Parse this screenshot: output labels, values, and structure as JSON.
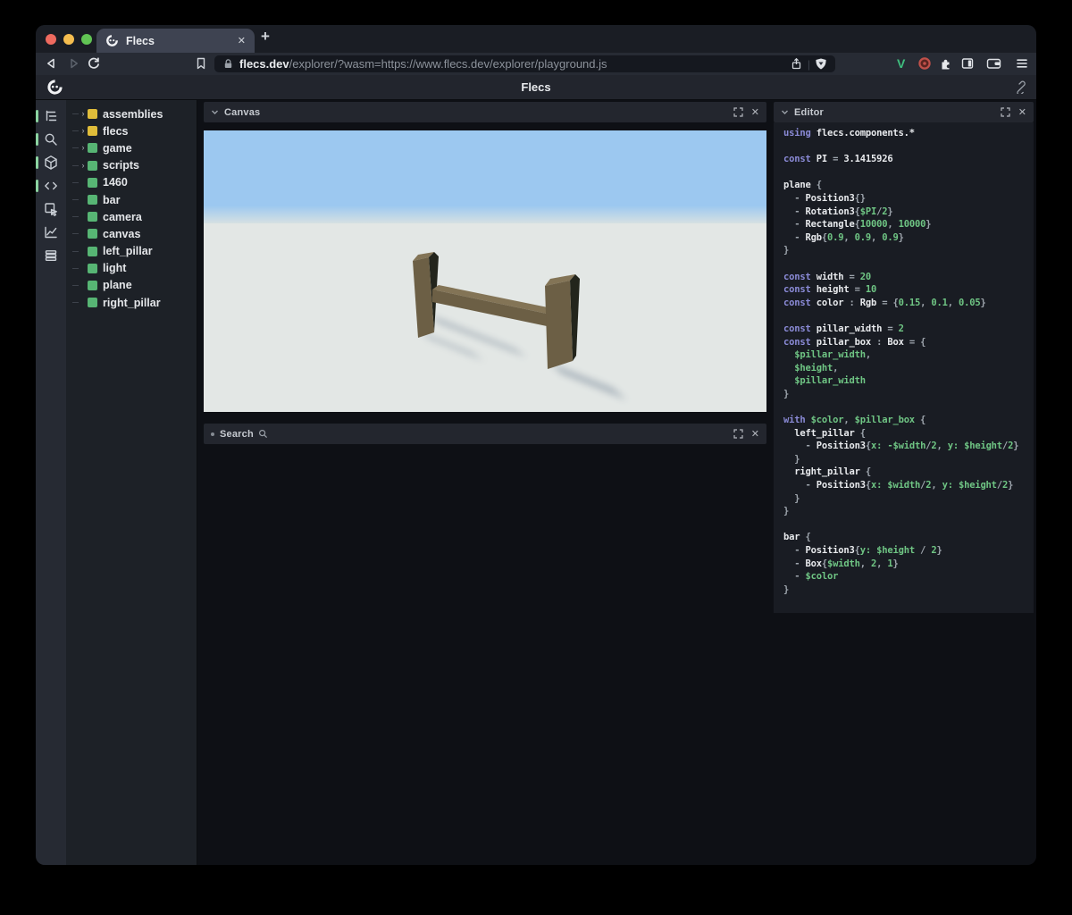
{
  "browser": {
    "traffic_lights": {
      "close": "#ee6a5f",
      "minimize": "#f5bd4f",
      "zoom": "#61c454"
    },
    "tab": {
      "title": "Flecs",
      "close_label": "✕"
    },
    "new_tab_label": "+",
    "url": {
      "domain": "flecs.dev",
      "path": "/explorer/?wasm=https://www.flecs.dev/explorer/playground.js"
    },
    "extensions": {
      "v_label": "V"
    }
  },
  "app": {
    "header": {
      "title": "Flecs"
    },
    "activity_bar": {
      "active_color": "#8bd3a0",
      "items": [
        {
          "name": "outliner",
          "active": true
        },
        {
          "name": "search",
          "active": true
        },
        {
          "name": "scene",
          "active": true
        },
        {
          "name": "script",
          "active": true
        },
        {
          "name": "inspect",
          "active": false
        },
        {
          "name": "stats",
          "active": false
        },
        {
          "name": "tables",
          "active": false
        }
      ]
    },
    "tree": {
      "colors": {
        "yellow": "#e0bd3a",
        "green": "#57b574"
      },
      "expander": "›",
      "items": [
        {
          "label": "assemblies",
          "dot": "yellow",
          "expandable": true
        },
        {
          "label": "flecs",
          "dot": "yellow",
          "expandable": true
        },
        {
          "label": "game",
          "dot": "green",
          "expandable": true
        },
        {
          "label": "scripts",
          "dot": "green",
          "expandable": true
        },
        {
          "label": "1460",
          "dot": "green",
          "expandable": false
        },
        {
          "label": "bar",
          "dot": "green",
          "expandable": false
        },
        {
          "label": "camera",
          "dot": "green",
          "expandable": false
        },
        {
          "label": "canvas",
          "dot": "green",
          "expandable": false
        },
        {
          "label": "left_pillar",
          "dot": "green",
          "expandable": false
        },
        {
          "label": "light",
          "dot": "green",
          "expandable": false
        },
        {
          "label": "plane",
          "dot": "green",
          "expandable": false
        },
        {
          "label": "right_pillar",
          "dot": "green",
          "expandable": false
        }
      ]
    },
    "panels": {
      "canvas": {
        "title": "Canvas",
        "close_label": "✕"
      },
      "search": {
        "title": "Search",
        "close_label": "✕"
      },
      "editor": {
        "title": "Editor",
        "close_label": "✕",
        "code_lines": [
          [
            {
              "t": "using ",
              "c": "k"
            },
            {
              "t": "flecs.components.*",
              "c": "i"
            }
          ],
          [],
          [
            {
              "t": "const ",
              "c": "k"
            },
            {
              "t": "PI",
              "c": "i"
            },
            {
              "t": " = ",
              "c": "p"
            },
            {
              "t": "3.1415926",
              "c": "i"
            }
          ],
          [],
          [
            {
              "t": "plane",
              "c": "i"
            },
            {
              "t": " {",
              "c": "p"
            }
          ],
          [
            {
              "t": "  - ",
              "c": "p"
            },
            {
              "t": "Position3",
              "c": "i"
            },
            {
              "t": "{}",
              "c": "p"
            }
          ],
          [
            {
              "t": "  - ",
              "c": "p"
            },
            {
              "t": "Rotation3",
              "c": "i"
            },
            {
              "t": "{",
              "c": "p"
            },
            {
              "t": "$PI",
              "c": "n"
            },
            {
              "t": "/",
              "c": "p"
            },
            {
              "t": "2",
              "c": "n"
            },
            {
              "t": "}",
              "c": "p"
            }
          ],
          [
            {
              "t": "  - ",
              "c": "p"
            },
            {
              "t": "Rectangle",
              "c": "i"
            },
            {
              "t": "{",
              "c": "p"
            },
            {
              "t": "10000",
              "c": "n"
            },
            {
              "t": ", ",
              "c": "p"
            },
            {
              "t": "10000",
              "c": "n"
            },
            {
              "t": "}",
              "c": "p"
            }
          ],
          [
            {
              "t": "  - ",
              "c": "p"
            },
            {
              "t": "Rgb",
              "c": "i"
            },
            {
              "t": "{",
              "c": "p"
            },
            {
              "t": "0.9",
              "c": "n"
            },
            {
              "t": ", ",
              "c": "p"
            },
            {
              "t": "0.9",
              "c": "n"
            },
            {
              "t": ", ",
              "c": "p"
            },
            {
              "t": "0.9",
              "c": "n"
            },
            {
              "t": "}",
              "c": "p"
            }
          ],
          [
            {
              "t": "}",
              "c": "p"
            }
          ],
          [],
          [
            {
              "t": "const ",
              "c": "k"
            },
            {
              "t": "width",
              "c": "i"
            },
            {
              "t": " = ",
              "c": "p"
            },
            {
              "t": "20",
              "c": "n"
            }
          ],
          [
            {
              "t": "const ",
              "c": "k"
            },
            {
              "t": "height",
              "c": "i"
            },
            {
              "t": " = ",
              "c": "p"
            },
            {
              "t": "10",
              "c": "n"
            }
          ],
          [
            {
              "t": "const ",
              "c": "k"
            },
            {
              "t": "color",
              "c": "i"
            },
            {
              "t": " : ",
              "c": "p"
            },
            {
              "t": "Rgb",
              "c": "i"
            },
            {
              "t": " = {",
              "c": "p"
            },
            {
              "t": "0.15",
              "c": "n"
            },
            {
              "t": ", ",
              "c": "p"
            },
            {
              "t": "0.1",
              "c": "n"
            },
            {
              "t": ", ",
              "c": "p"
            },
            {
              "t": "0.05",
              "c": "n"
            },
            {
              "t": "}",
              "c": "p"
            }
          ],
          [],
          [
            {
              "t": "const ",
              "c": "k"
            },
            {
              "t": "pillar_width",
              "c": "i"
            },
            {
              "t": " = ",
              "c": "p"
            },
            {
              "t": "2",
              "c": "n"
            }
          ],
          [
            {
              "t": "const ",
              "c": "k"
            },
            {
              "t": "pillar_box",
              "c": "i"
            },
            {
              "t": " : ",
              "c": "p"
            },
            {
              "t": "Box",
              "c": "i"
            },
            {
              "t": " = {",
              "c": "p"
            }
          ],
          [
            {
              "t": "  $pillar_width",
              "c": "n"
            },
            {
              "t": ",",
              "c": "p"
            }
          ],
          [
            {
              "t": "  $height",
              "c": "n"
            },
            {
              "t": ",",
              "c": "p"
            }
          ],
          [
            {
              "t": "  $pillar_width",
              "c": "n"
            }
          ],
          [
            {
              "t": "}",
              "c": "p"
            }
          ],
          [],
          [
            {
              "t": "with ",
              "c": "k"
            },
            {
              "t": "$color",
              "c": "n"
            },
            {
              "t": ", ",
              "c": "p"
            },
            {
              "t": "$pillar_box",
              "c": "n"
            },
            {
              "t": " {",
              "c": "p"
            }
          ],
          [
            {
              "t": "  left_pillar",
              "c": "i"
            },
            {
              "t": " {",
              "c": "p"
            }
          ],
          [
            {
              "t": "    - ",
              "c": "p"
            },
            {
              "t": "Position3",
              "c": "i"
            },
            {
              "t": "{",
              "c": "p"
            },
            {
              "t": "x:",
              "c": "n"
            },
            {
              "t": " ",
              "c": "p"
            },
            {
              "t": "-$width",
              "c": "n"
            },
            {
              "t": "/",
              "c": "p"
            },
            {
              "t": "2",
              "c": "n"
            },
            {
              "t": ", ",
              "c": "p"
            },
            {
              "t": "y:",
              "c": "n"
            },
            {
              "t": " ",
              "c": "p"
            },
            {
              "t": "$height",
              "c": "n"
            },
            {
              "t": "/",
              "c": "p"
            },
            {
              "t": "2",
              "c": "n"
            },
            {
              "t": "}",
              "c": "p"
            }
          ],
          [
            {
              "t": "  }",
              "c": "p"
            }
          ],
          [
            {
              "t": "  right_pillar",
              "c": "i"
            },
            {
              "t": " {",
              "c": "p"
            }
          ],
          [
            {
              "t": "    - ",
              "c": "p"
            },
            {
              "t": "Position3",
              "c": "i"
            },
            {
              "t": "{",
              "c": "p"
            },
            {
              "t": "x:",
              "c": "n"
            },
            {
              "t": " ",
              "c": "p"
            },
            {
              "t": "$width",
              "c": "n"
            },
            {
              "t": "/",
              "c": "p"
            },
            {
              "t": "2",
              "c": "n"
            },
            {
              "t": ", ",
              "c": "p"
            },
            {
              "t": "y:",
              "c": "n"
            },
            {
              "t": " ",
              "c": "p"
            },
            {
              "t": "$height",
              "c": "n"
            },
            {
              "t": "/",
              "c": "p"
            },
            {
              "t": "2",
              "c": "n"
            },
            {
              "t": "}",
              "c": "p"
            }
          ],
          [
            {
              "t": "  }",
              "c": "p"
            }
          ],
          [
            {
              "t": "}",
              "c": "p"
            }
          ],
          [],
          [
            {
              "t": "bar",
              "c": "i"
            },
            {
              "t": " {",
              "c": "p"
            }
          ],
          [
            {
              "t": "  - ",
              "c": "p"
            },
            {
              "t": "Position3",
              "c": "i"
            },
            {
              "t": "{",
              "c": "p"
            },
            {
              "t": "y:",
              "c": "n"
            },
            {
              "t": " ",
              "c": "p"
            },
            {
              "t": "$height",
              "c": "n"
            },
            {
              "t": " / ",
              "c": "p"
            },
            {
              "t": "2",
              "c": "n"
            },
            {
              "t": "}",
              "c": "p"
            }
          ],
          [
            {
              "t": "  - ",
              "c": "p"
            },
            {
              "t": "Box",
              "c": "i"
            },
            {
              "t": "{",
              "c": "p"
            },
            {
              "t": "$width",
              "c": "n"
            },
            {
              "t": ", ",
              "c": "p"
            },
            {
              "t": "2",
              "c": "n"
            },
            {
              "t": ", ",
              "c": "p"
            },
            {
              "t": "1",
              "c": "n"
            },
            {
              "t": "}",
              "c": "p"
            }
          ],
          [
            {
              "t": "  - ",
              "c": "p"
            },
            {
              "t": "$color",
              "c": "n"
            }
          ],
          [
            {
              "t": "}",
              "c": "p"
            }
          ]
        ]
      }
    },
    "scene": {
      "sky": "#9cc8f0",
      "horizon": "#dce3e1",
      "ground": "#e3e7e5",
      "wood_front": "#6c5f45",
      "wood_top": "#837456",
      "wood_dark": "#23251c",
      "shadow": "#66788c"
    }
  }
}
